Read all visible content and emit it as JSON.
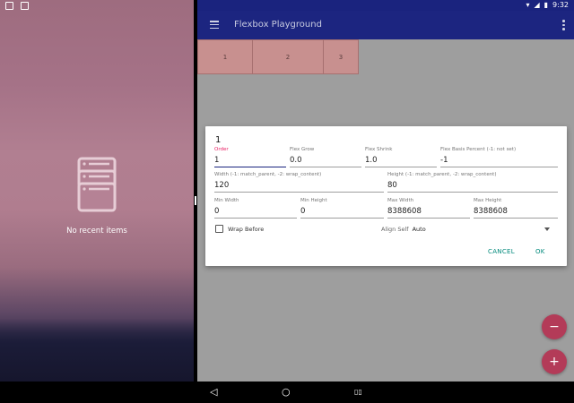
{
  "recents": {
    "empty_text": "No recent items"
  },
  "status": {
    "time": "9:32"
  },
  "app": {
    "title": "Flexbox Playground",
    "flex_items": [
      {
        "label": "1"
      },
      {
        "label": "2"
      },
      {
        "label": "3"
      }
    ]
  },
  "dialog": {
    "title": "1",
    "fields": {
      "order": {
        "label": "Order",
        "value": "1"
      },
      "flex_grow": {
        "label": "Flex Grow",
        "value": "0.0"
      },
      "flex_shrink": {
        "label": "Flex Shrink",
        "value": "1.0"
      },
      "flex_basis": {
        "label": "Flex Basis Percent (-1: not set)",
        "value": "-1"
      },
      "width": {
        "label": "Width (-1: match_parent, -2: wrap_content)",
        "value": "120"
      },
      "height": {
        "label": "Height (-1: match_parent, -2: wrap_content)",
        "value": "80"
      },
      "min_width": {
        "label": "Min Width",
        "value": "0"
      },
      "min_height": {
        "label": "Min Height",
        "value": "0"
      },
      "max_width": {
        "label": "Max Width",
        "value": "8388608"
      },
      "max_height": {
        "label": "Max Height",
        "value": "8388608"
      }
    },
    "wrap_before_label": "Wrap Before",
    "align_self_label": "Align Self",
    "align_self_value": "Auto",
    "cancel_label": "CANCEL",
    "ok_label": "OK"
  },
  "fabs": {
    "remove": "−",
    "add": "+"
  },
  "nav": {
    "back": "◁",
    "home": "○",
    "recents": "▯▯"
  },
  "colors": {
    "appbar": "#1c2580",
    "accent": "#e91e63",
    "fab": "#b33b58",
    "dialog_button": "#00897b",
    "flex_item": "#c8908f"
  }
}
